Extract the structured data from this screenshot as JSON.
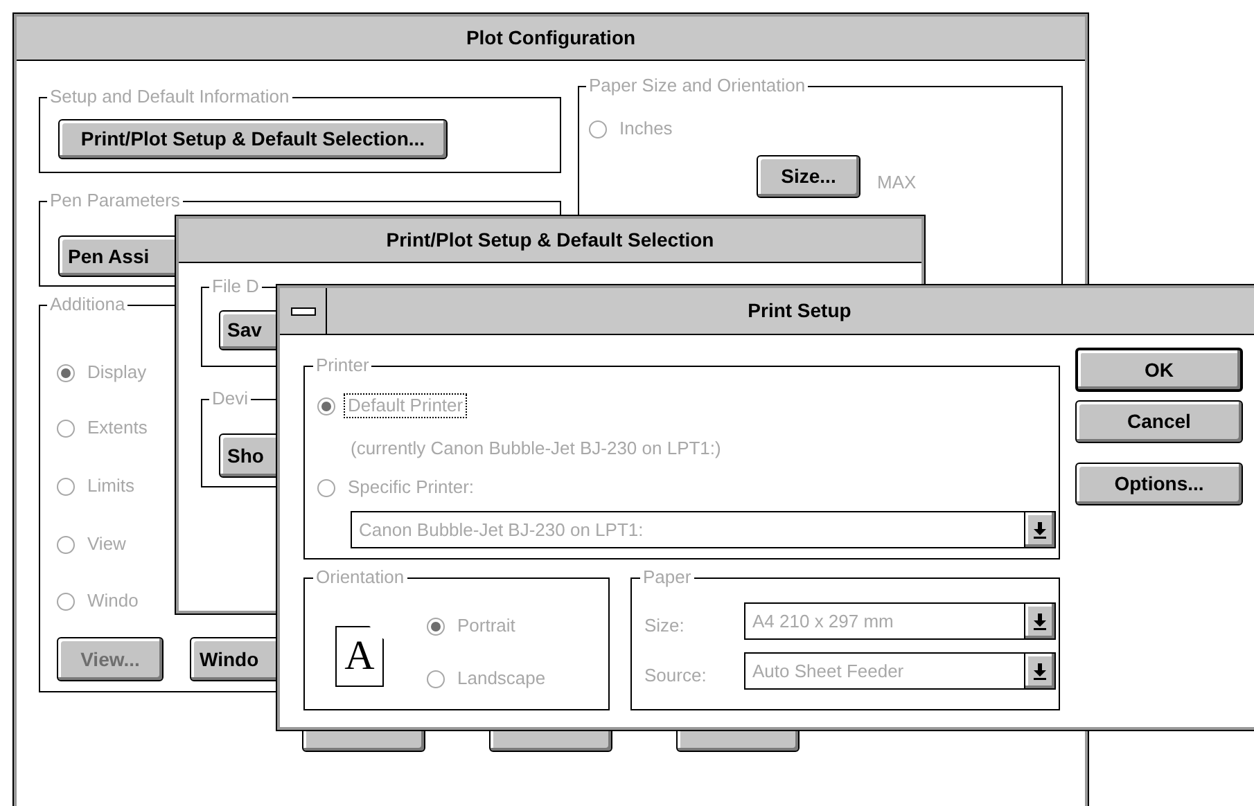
{
  "plot_configuration": {
    "title": "Plot Configuration",
    "setup_group": {
      "label": "Setup and Default Information",
      "disabled": true,
      "button": {
        "label": "Print/Plot Setup & Default Selection...",
        "disabled": false
      }
    },
    "pen_group": {
      "label": "Pen Parameters",
      "disabled": true,
      "button": {
        "label": "Pen Assi",
        "disabled": false
      }
    },
    "additional_group": {
      "label": "Additiona",
      "disabled": true,
      "options": [
        {
          "label": "Display",
          "selected": true
        },
        {
          "label": "Extents",
          "selected": false
        },
        {
          "label": "Limits",
          "selected": false
        },
        {
          "label": "View",
          "selected": false
        },
        {
          "label": "Windo",
          "selected": false
        }
      ],
      "buttons": [
        {
          "label": "View...",
          "disabled": true
        },
        {
          "label": "Windo",
          "disabled": false
        }
      ]
    },
    "paper_group": {
      "label": "Paper Size and Orientation",
      "disabled": true,
      "units": [
        {
          "label": "Inches",
          "selected": false
        }
      ],
      "size_button": {
        "label": "Size...",
        "disabled": false
      },
      "size_value": "MAX"
    },
    "buttons": [
      {
        "kind": "button"
      },
      {
        "kind": "button"
      },
      {
        "kind": "button"
      }
    ]
  },
  "print_plot_setup": {
    "title": "Print/Plot Setup & Default Selection",
    "file_group": {
      "label": "File D",
      "disabled": true,
      "button": {
        "label": "Sav",
        "disabled": false
      }
    },
    "device_group": {
      "label": "Devi",
      "disabled": true,
      "button": {
        "label": "Sho",
        "disabled": false
      }
    }
  },
  "print_setup": {
    "title": "Print Setup",
    "printer_group": {
      "label": "Printer",
      "disabled": true,
      "options": [
        {
          "label": "Default Printer",
          "selected": true,
          "focused": true
        },
        {
          "label": "Specific Printer:",
          "selected": false,
          "focused": false
        }
      ],
      "current": "(currently Canon Bubble-Jet BJ-230 on LPT1:)",
      "printer_select": "Canon Bubble-Jet BJ-230 on LPT1:"
    },
    "orientation_group": {
      "label": "Orientation",
      "disabled": true,
      "icon_text": "A",
      "options": [
        {
          "label": "Portrait",
          "selected": true
        },
        {
          "label": "Landscape",
          "selected": false
        }
      ]
    },
    "paper_group": {
      "label": "Paper",
      "disabled": true,
      "fields": [
        {
          "label": "Size:",
          "value": "A4 210 x 297 mm"
        },
        {
          "label": "Source:",
          "value": "Auto Sheet Feeder"
        }
      ]
    },
    "buttons": [
      {
        "label": "OK",
        "default": true
      },
      {
        "label": "Cancel",
        "default": false
      },
      {
        "label": "Options...",
        "default": false
      }
    ]
  }
}
